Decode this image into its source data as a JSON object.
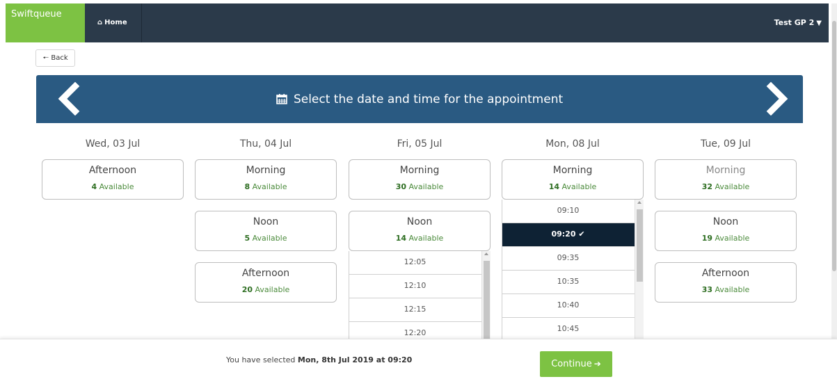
{
  "topbar": {
    "brand": "Swiftqueue",
    "home_label": "Home",
    "home_icon": "home-icon",
    "user_label": "Test GP 2",
    "user_icon": "chevron-down-icon"
  },
  "back_button": {
    "label": "Back",
    "icon": "arrow-left-icon"
  },
  "panel": {
    "title": "Select the date and time for the appointment",
    "icon": "calendar-icon",
    "prev_icon": "chevron-left-icon",
    "next_icon": "chevron-right-icon"
  },
  "available_word": "Available",
  "days": [
    {
      "label": "Wed, 03 Jul",
      "slots": [
        {
          "name": "Afternoon",
          "count": "4"
        }
      ]
    },
    {
      "label": "Thu, 04 Jul",
      "slots": [
        {
          "name": "Morning",
          "count": "8"
        },
        {
          "name": "Noon",
          "count": "5"
        },
        {
          "name": "Afternoon",
          "count": "20"
        }
      ]
    },
    {
      "label": "Fri, 05 Jul",
      "slots": [
        {
          "name": "Morning",
          "count": "30"
        },
        {
          "name": "Noon",
          "count": "14"
        }
      ],
      "times": [
        "12:05",
        "12:10",
        "12:15",
        "12:20"
      ]
    },
    {
      "label": "Mon, 08 Jul",
      "slots": [
        {
          "name": "Morning",
          "count": "14"
        }
      ],
      "times": [
        "09:10",
        "09:20",
        "09:35",
        "10:35",
        "10:40",
        "10:45"
      ],
      "selected_time": "09:20"
    },
    {
      "label": "Tue, 09 Jul",
      "slots": [
        {
          "name": "Morning",
          "count": "32"
        },
        {
          "name": "Noon",
          "count": "19"
        },
        {
          "name": "Afternoon",
          "count": "33"
        }
      ]
    }
  ],
  "footer": {
    "selection_prefix": "You have selected",
    "selection_value": "Mon, 8th Jul 2019 at 09:20",
    "continue_label": "Continue",
    "continue_icon": "arrow-right-icon"
  },
  "colors": {
    "brand_green": "#7dc243",
    "topbar": "#2b3a4a",
    "panel_blue": "#2a5a82",
    "selected_row": "#0e2234",
    "available_green": "#4a8a3a"
  }
}
